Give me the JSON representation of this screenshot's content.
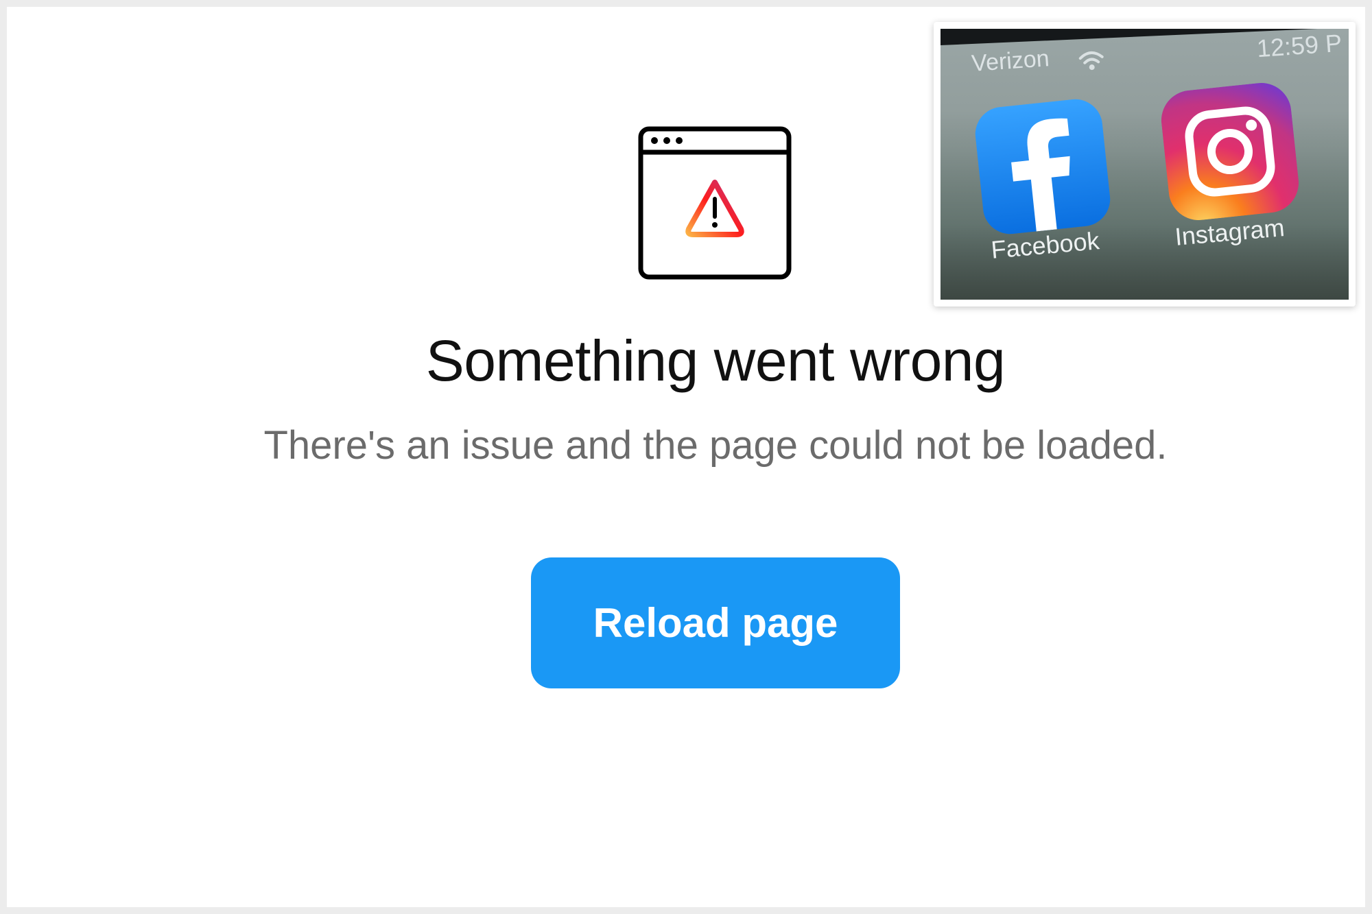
{
  "error": {
    "title": "Something went wrong",
    "message": "There's an issue and the page could not be loaded.",
    "icon": "browser-warning-icon"
  },
  "actions": {
    "reload_label": "Reload page"
  },
  "inset_photo": {
    "status_bar": {
      "carrier": "Verizon",
      "time": "12:59 P"
    },
    "apps": [
      {
        "label": "Facebook",
        "icon": "facebook-icon"
      },
      {
        "label": "Instagram",
        "icon": "instagram-icon"
      }
    ]
  },
  "colors": {
    "button": "#1a98f5",
    "title": "#111111",
    "message": "#6b6b6b",
    "facebook": "#1877f2"
  }
}
